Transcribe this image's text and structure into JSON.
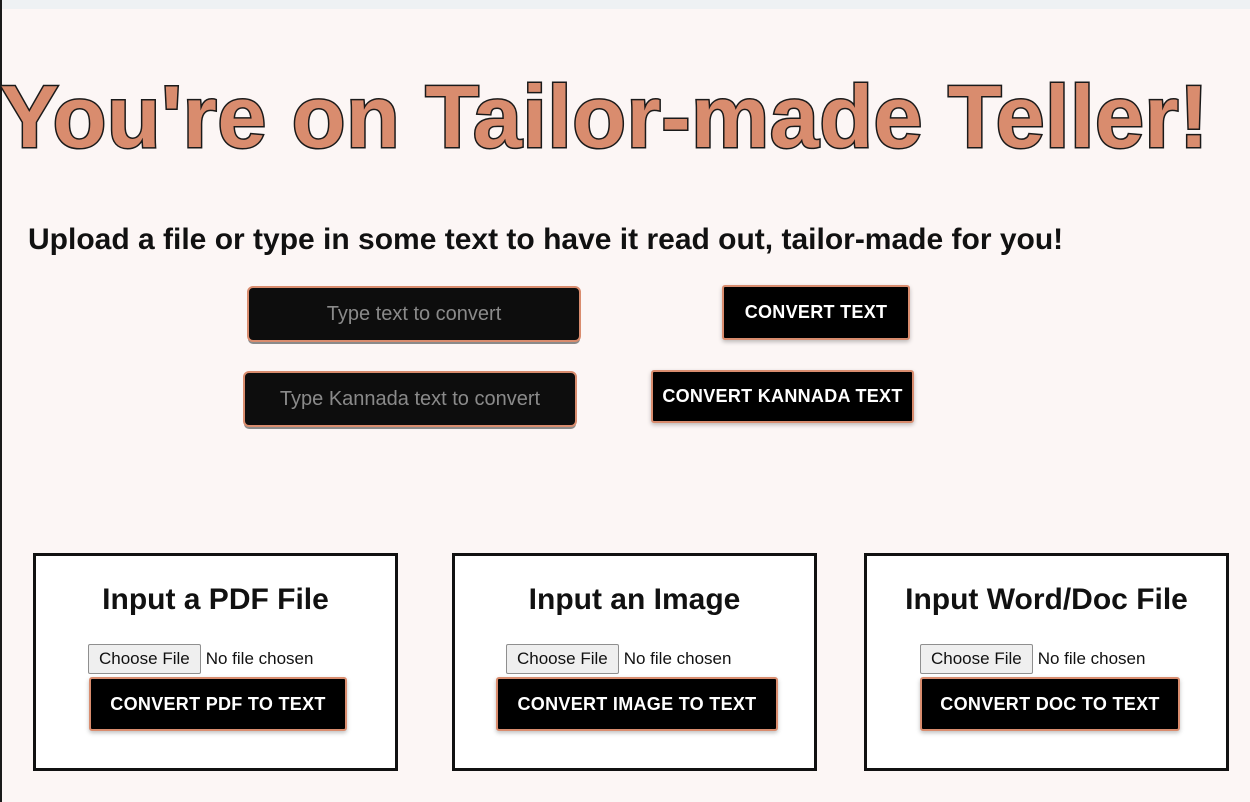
{
  "header": {
    "title": "You're on Tailor-made Teller!",
    "subtitle": "Upload a file or type in some text to have it read out, tailor-made for you!"
  },
  "text_section": {
    "english_input": {
      "placeholder": "Type text to convert",
      "value": ""
    },
    "kannada_input": {
      "placeholder": "Type Kannada text to convert",
      "value": ""
    },
    "convert_text_label": "Convert Text",
    "convert_kannada_label": "Convert Kannada Text"
  },
  "cards": [
    {
      "title": "Input a PDF File",
      "choose_label": "Choose File",
      "file_status": "No file chosen",
      "button_label": "Convert PDF to Text"
    },
    {
      "title": "Input an Image",
      "choose_label": "Choose File",
      "file_status": "No file chosen",
      "button_label": "Convert Image to Text"
    },
    {
      "title": "Input Word/Doc File",
      "choose_label": "Choose File",
      "file_status": "No file chosen",
      "button_label": "Convert Doc to Text"
    }
  ],
  "colors": {
    "accent": "#d98c6e",
    "background": "#fcf6f5",
    "button_bg": "#000000",
    "card_bg": "#ffffff"
  }
}
